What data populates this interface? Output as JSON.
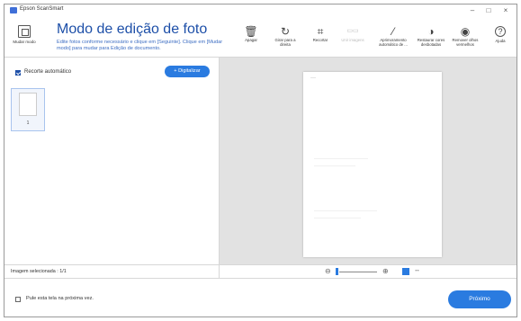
{
  "window": {
    "title": "Epson ScanSmart"
  },
  "controls": {
    "minimize": "–",
    "maximize": "□",
    "close": "×"
  },
  "toolbar": {
    "mode_button": "Mudar modo",
    "title": "Modo de edição de foto",
    "description": "Edite fotos conforme necessário e clique em [Seguinte]. Clique em [Mudar modo] para mudar para Edição de documento.",
    "tools": [
      {
        "id": "apagar",
        "label": "Apagar",
        "icon": "trash-icon",
        "glyph": "🗑"
      },
      {
        "id": "girar",
        "label": "Girar para a direita",
        "icon": "rotate-right-icon",
        "glyph": "↻"
      },
      {
        "id": "recortar",
        "label": "Recortar",
        "icon": "crop-icon",
        "glyph": "⌗"
      },
      {
        "id": "unir",
        "label": "Unir imagens",
        "icon": "merge-images-icon",
        "glyph": "▭▭"
      },
      {
        "id": "aprimoramento",
        "label": "Aprimoramento automático de ...",
        "icon": "magic-wand-icon",
        "glyph": "⁄"
      },
      {
        "id": "restaurar",
        "label": "Restaurar cores desbotadas",
        "icon": "color-restore-icon",
        "glyph": "◑"
      },
      {
        "id": "olhos",
        "label": "Remover olhos vermelhos",
        "icon": "eye-icon",
        "glyph": "◉"
      },
      {
        "id": "ajuda",
        "label": "Ajuda",
        "icon": "help-icon",
        "glyph": "?"
      }
    ]
  },
  "left_panel": {
    "auto_crop_label": "Recorte automático",
    "auto_crop_checked": true,
    "scan_button": "+ Digitalizar",
    "thumbnail_number": "1"
  },
  "status": {
    "selected_text": "Imagem selecionada : 1/1",
    "zoom_out": "⊖",
    "zoom_in": "⊕",
    "arrows": "↔"
  },
  "footer": {
    "skip_label": "Pule esta tela na próxima vez.",
    "next_button": "Próximo"
  },
  "colors": {
    "accent": "#2a7be0",
    "title": "#1d4fa8"
  }
}
